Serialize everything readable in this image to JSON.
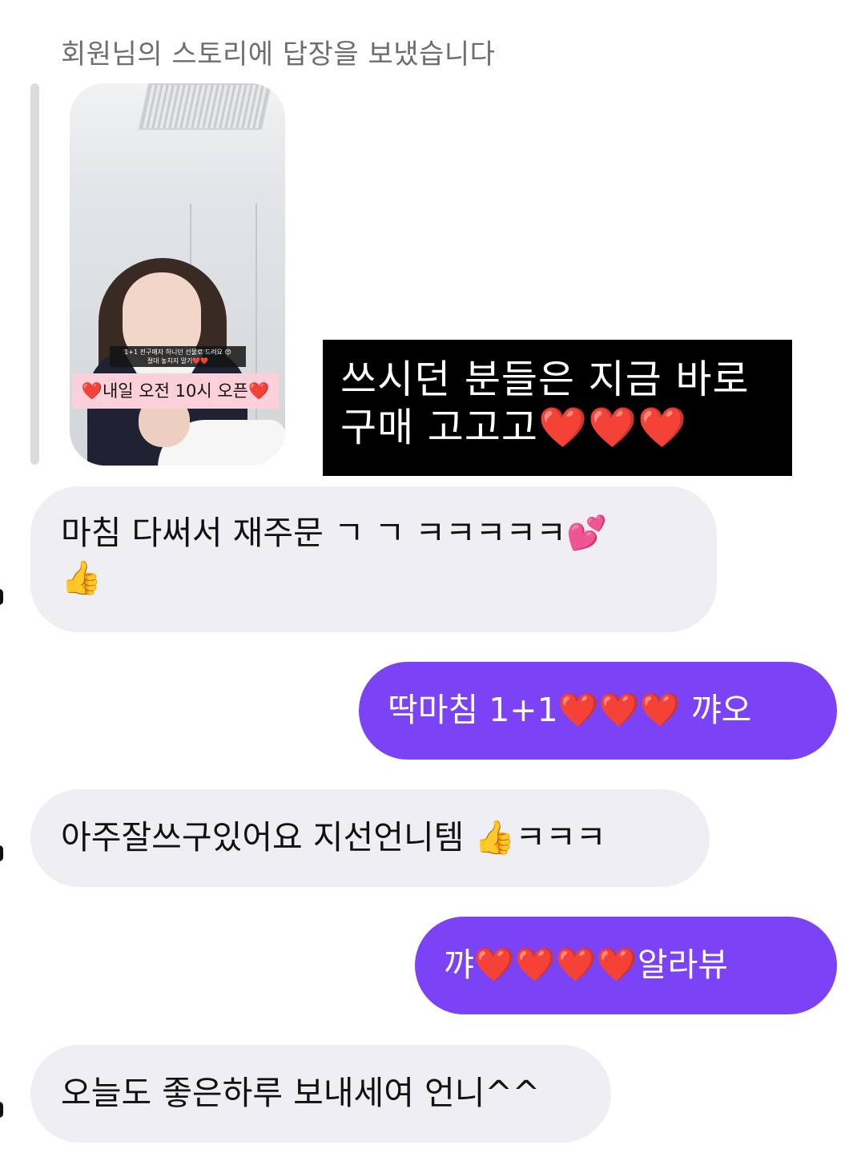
{
  "reply_header": "회원님의 스토리에 답장을 보냈습니다",
  "story": {
    "caption_line1": "1+1 전구매자 하니던 선물로 드려요 😍",
    "caption_line2": "절대 놓치지 말기❤️❤️",
    "sticker": "❤️내일 오전 10시 오픈❤️",
    "overlay_line1": "쓰시던 분들은 지금 바로",
    "overlay_line2": "구매 고고고❤️❤️❤️"
  },
  "messages": [
    {
      "direction": "incoming",
      "lines": [
        "마침 다써서 재주문 ㄱ ㄱ  ㅋㅋㅋㅋㅋ💕",
        "👍"
      ]
    },
    {
      "direction": "outgoing",
      "lines": [
        "딱마침 1+1❤️❤️❤️ 꺄오"
      ]
    },
    {
      "direction": "incoming",
      "lines": [
        "아주잘쓰구있어요 지선언니템 👍ㅋㅋㅋ"
      ]
    },
    {
      "direction": "outgoing",
      "lines": [
        "꺄❤️❤️❤️❤️알라뷰"
      ]
    },
    {
      "direction": "incoming",
      "lines": [
        "오늘도 좋은하루 보내세여 언니^^"
      ]
    }
  ],
  "colors": {
    "outgoing_bubble": "#7b42f6",
    "incoming_bubble": "#efeff3",
    "header_text": "#6e6e6e",
    "overlay_bg": "#000000"
  }
}
